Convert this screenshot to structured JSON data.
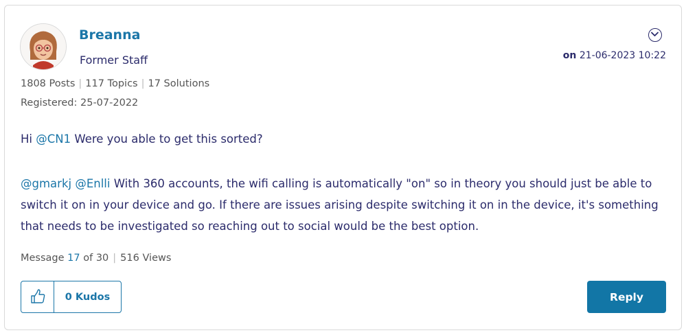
{
  "author": {
    "name": "Breanna",
    "rank": "Former Staff",
    "avatar_icon": "memoji-avatar",
    "stats": {
      "posts": "1808 Posts",
      "topics": "117 Topics",
      "solutions": "17 Solutions"
    },
    "registered": "Registered: 25-07-2022"
  },
  "post": {
    "date_prefix": "on",
    "date": "21-06-2023 10:22",
    "menu_icon": "chevron-down-icon",
    "p1": {
      "pre": "Hi ",
      "mention": "@CN1",
      "text": " Were you able to get this sorted?"
    },
    "p2": {
      "mention1": "@gmarkj",
      "mention2": "@Enlli",
      "text": " With 360 accounts, the wifi calling is automatically \"on\" so in theory you should just be able to switch it on in your device and go. If there are issues arising despite switching it on in the device, it's something that needs to be investigated so reaching out to social would be the best option."
    },
    "meta": {
      "message_label": "Message",
      "message_num": "17",
      "of_total": "of 30",
      "views": "516 Views"
    }
  },
  "actions": {
    "kudos_icon": "thumbs-up-icon",
    "kudos_label": "0 Kudos",
    "reply_label": "Reply"
  },
  "colors": {
    "link": "#1b76a8",
    "text": "#2b2b6b",
    "reply_bg": "#1276a6"
  }
}
